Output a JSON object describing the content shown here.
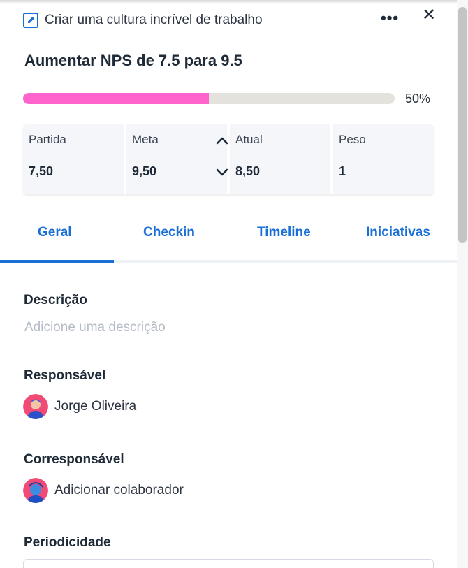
{
  "header": {
    "objective_title": "Criar uma cultura incrível de trabalho",
    "more_symbol": "•••",
    "close_symbol": "✕",
    "objective_icon": "edit-square-icon"
  },
  "key_result": {
    "title": "Aumentar NPS de 7.5 para 9.5"
  },
  "progress": {
    "fraction": 0.5,
    "label": "50%",
    "fill_color": "#ff63cc",
    "track_color": "#e3e2dc"
  },
  "metrics": [
    {
      "label": "Partida",
      "value": "7,50"
    },
    {
      "label": "Meta",
      "value": "9,50"
    },
    {
      "label": "Atual",
      "value": "8,50"
    },
    {
      "label": "Peso",
      "value": "1"
    }
  ],
  "tabs": [
    {
      "label": "Geral",
      "active": true
    },
    {
      "label": "Checkin",
      "active": false
    },
    {
      "label": "Timeline",
      "active": false
    },
    {
      "label": "Iniciativas",
      "active": false
    }
  ],
  "sections": {
    "description_label": "Descrição",
    "description_placeholder": "Adicione uma descrição",
    "owner_label": "Responsável",
    "owner_name": "Jorge Oliveira",
    "coowner_label": "Corresponsável",
    "coowner_action": "Adicionar colaborador",
    "periodicity_label": "Periodicidade"
  },
  "colors": {
    "accent": "#1a6fd6",
    "text": "#1f2a37",
    "placeholder": "#b5bcc6"
  }
}
